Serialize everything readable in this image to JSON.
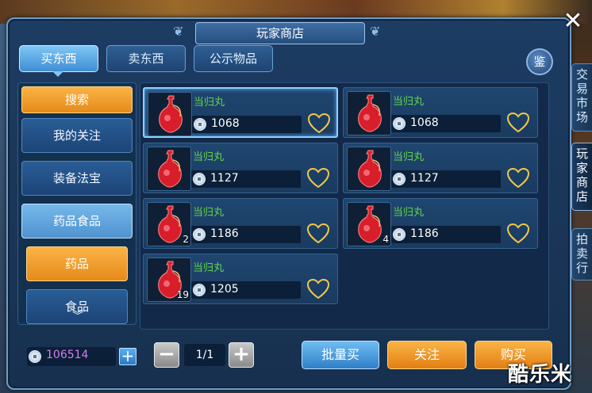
{
  "window": {
    "title": "玩家商店"
  },
  "tabs": [
    {
      "label": "买东西"
    },
    {
      "label": "卖东西"
    },
    {
      "label": "公示物品"
    }
  ],
  "appraise_label": "鉴",
  "side_tabs": [
    {
      "label": [
        "交",
        "易",
        "市",
        "场"
      ]
    },
    {
      "label": [
        "玩",
        "家",
        "商",
        "店"
      ]
    },
    {
      "label": [
        "拍",
        "卖",
        "行"
      ]
    }
  ],
  "categories": {
    "search": "搜索",
    "items": [
      "我的关注",
      "装备法宝",
      "药品食品"
    ],
    "sub_items": [
      "药品",
      "食品"
    ]
  },
  "items": [
    {
      "name": "当归丸",
      "price": "1068",
      "count": ""
    },
    {
      "name": "当归丸",
      "price": "1068",
      "count": ""
    },
    {
      "name": "当归丸",
      "price": "1127",
      "count": ""
    },
    {
      "name": "当归丸",
      "price": "1127",
      "count": ""
    },
    {
      "name": "当归丸",
      "price": "1186",
      "count": "2"
    },
    {
      "name": "当归丸",
      "price": "1186",
      "count": "4"
    },
    {
      "name": "当归丸",
      "price": "1205",
      "count": "19"
    }
  ],
  "footer": {
    "money": "106514",
    "page": "1/1",
    "batch_buy": "批量买",
    "follow": "关注",
    "buy": "购买"
  },
  "watermark": "酷乐米",
  "colors": {
    "item_name": "#62d24a",
    "money": "#d67cf0",
    "orange_button": "#e58a1a",
    "blue_button": "#2f7fc8"
  }
}
